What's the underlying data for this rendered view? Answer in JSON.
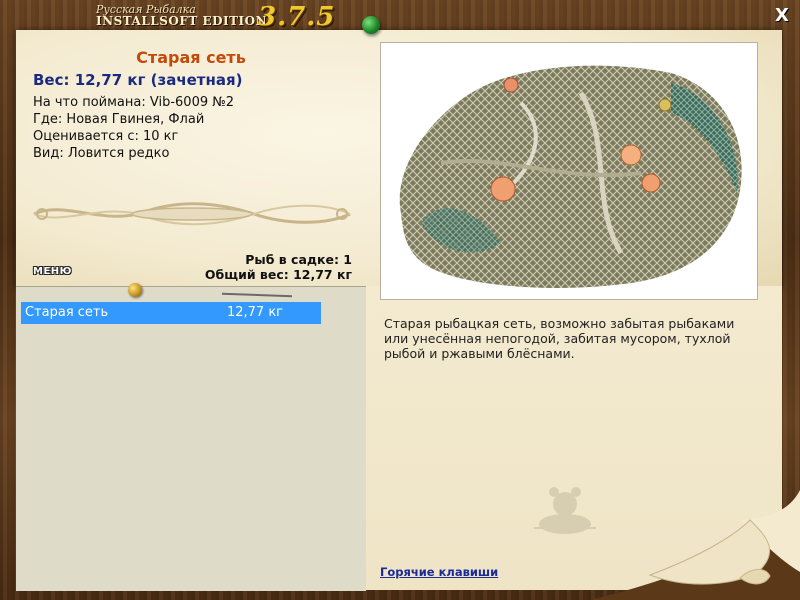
{
  "window": {
    "logo_top": "Русская Рыбалка",
    "logo_edition": "INSTALLSOFT EDITION",
    "logo_version": "3.7.5",
    "close_label": "X"
  },
  "fish": {
    "name": "Старая сеть",
    "weight_line": "Вес: 12,77 кг (зачетная)",
    "caught_with": "На что поймана: Vib-6009 №2",
    "location": "Где: Новая Гвинея, Флай",
    "valued_from": "Оценивается с: 10 кг",
    "kind": "Вид: Ловится редко",
    "description": "Старая рыбацкая сеть, возможно забытая рыбаками или унесённая непогодой, забитая мусором, тухлой рыбой и ржавыми блёснами."
  },
  "keepnet": {
    "count_line": "Рыб в садке: 1",
    "total_line": "Общий вес: 12,77 кг",
    "items": [
      {
        "name": "Старая сеть",
        "weight": "12,77 кг"
      }
    ]
  },
  "menu": {
    "label": "МЕНЮ"
  },
  "links": {
    "hotkeys": "Горячие клавиши"
  },
  "colors": {
    "fish_name": "#c34a0a",
    "weight": "#1a2a80",
    "selection": "#3399ff",
    "link": "#1a2a9a",
    "version": "#f0c830"
  }
}
